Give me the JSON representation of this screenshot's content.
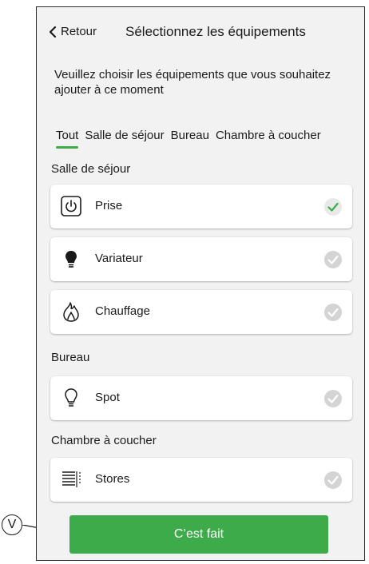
{
  "header": {
    "back_label": "Retour",
    "title": "Sélectionnez les équipements"
  },
  "intro_text": "Veuillez choisir les équipements que vous souhaitez ajouter à ce moment",
  "tabs": [
    {
      "label": "Tout",
      "active": true
    },
    {
      "label": "Salle de séjour",
      "active": false
    },
    {
      "label": "Bureau",
      "active": false
    },
    {
      "label": "Chambre à coucher",
      "active": false
    }
  ],
  "sections": [
    {
      "label": "Salle de séjour",
      "items": [
        {
          "label": "Prise",
          "icon": "power-socket-icon",
          "selected": true
        },
        {
          "label": "Variateur",
          "icon": "dimmer-bulb-icon",
          "selected": false
        },
        {
          "label": "Chauffage",
          "icon": "flame-icon",
          "selected": false
        }
      ]
    },
    {
      "label": "Bureau",
      "items": [
        {
          "label": "Spot",
          "icon": "bulb-icon",
          "selected": false
        }
      ]
    },
    {
      "label": "Chambre à coucher",
      "items": [
        {
          "label": "Stores",
          "icon": "blinds-icon",
          "selected": false
        }
      ]
    }
  ],
  "done_button": "C’est fait",
  "callout": "V",
  "colors": {
    "accent": "#3dab4a",
    "background": "#f2f2f2",
    "check_inactive": "#cccccc"
  }
}
